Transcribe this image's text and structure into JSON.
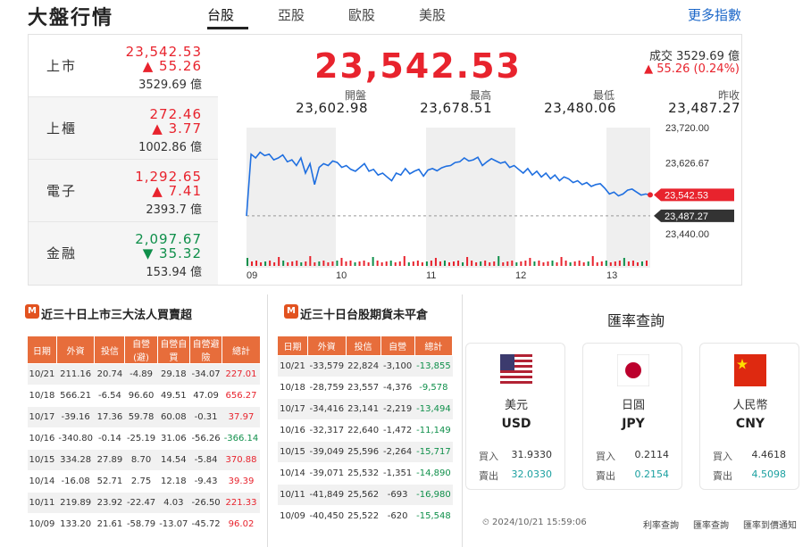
{
  "header": {
    "title": "大盤行情",
    "tabs": [
      "台股",
      "亞股",
      "歐股",
      "美股"
    ],
    "more": "更多指數"
  },
  "indices": [
    {
      "name": "上市",
      "value": "23,542.53",
      "change": "55.26",
      "volume": "3529.69 億",
      "dir": "up"
    },
    {
      "name": "上櫃",
      "value": "272.46",
      "change": "3.77",
      "volume": "1002.86 億",
      "dir": "up"
    },
    {
      "name": "電子",
      "value": "1,292.65",
      "change": "7.41",
      "volume": "2393.7 億",
      "dir": "up"
    },
    {
      "name": "金融",
      "value": "2,097.67",
      "change": "35.32",
      "volume": "153.94 億",
      "dir": "down"
    }
  ],
  "main": {
    "price": "23,542.53",
    "volume_label": "成交",
    "volume": "3529.69 億",
    "change": "▲ 55.26 (0.24%)",
    "ohlc": [
      {
        "label": "開盤",
        "value": "23,602.98"
      },
      {
        "label": "最高",
        "value": "23,678.51"
      },
      {
        "label": "最低",
        "value": "23,480.06"
      },
      {
        "label": "昨收",
        "value": "23,487.27"
      }
    ]
  },
  "chart_data": {
    "type": "line",
    "x_ticks": [
      "09",
      "10",
      "11",
      "12",
      "13"
    ],
    "y_ticks": [
      "23,720.00",
      "23,626.67",
      "23,440.00"
    ],
    "ylim": [
      23440,
      23720
    ],
    "current_label": "23,542.53",
    "prev_close_label": "23,487.27",
    "current": 23542.53,
    "prev_close": 23487.27,
    "colors": {
      "line": "#1f6fe0",
      "up": "#e8232d",
      "ref": "#333333"
    },
    "series": [
      {
        "values": [
          23487,
          23650,
          23640,
          23655,
          23646,
          23650,
          23635,
          23640,
          23648,
          23630,
          23635,
          23620,
          23640,
          23600,
          23625,
          23570,
          23615,
          23625,
          23620,
          23632,
          23628,
          23615,
          23620,
          23610,
          23605,
          23615,
          23625,
          23605,
          23610,
          23595,
          23600,
          23590,
          23580,
          23600,
          23595,
          23612,
          23598,
          23605,
          23610,
          23592,
          23608,
          23612,
          23606,
          23614,
          23618,
          23620,
          23628,
          23630,
          23640,
          23632,
          23635,
          23642,
          23620,
          23630,
          23638,
          23632,
          23626,
          23630,
          23615,
          23620,
          23610,
          23600,
          23612,
          23595,
          23605,
          23590,
          23600,
          23585,
          23595,
          23580,
          23590,
          23585,
          23575,
          23580,
          23570,
          23575,
          23565,
          23570,
          23572,
          23560,
          23545,
          23550,
          23540,
          23545,
          23555,
          23558,
          23550,
          23542,
          23545,
          23542
        ]
      }
    ]
  },
  "inst_table": {
    "title": "近三十日上市三大法人買賣超",
    "headers": [
      "日期",
      "外資",
      "投信",
      "自營(避)",
      "自營自買",
      "自營避險",
      "總計"
    ],
    "rows": [
      [
        "10/21",
        "211.16",
        "20.74",
        "-4.89",
        "29.18",
        "-34.07",
        "227.01"
      ],
      [
        "10/18",
        "566.21",
        "-6.54",
        "96.60",
        "49.51",
        "47.09",
        "656.27"
      ],
      [
        "10/17",
        "-39.16",
        "17.36",
        "59.78",
        "60.08",
        "-0.31",
        "37.97"
      ],
      [
        "10/16",
        "-340.80",
        "-0.14",
        "-25.19",
        "31.06",
        "-56.26",
        "-366.14"
      ],
      [
        "10/15",
        "334.28",
        "27.89",
        "8.70",
        "14.54",
        "-5.84",
        "370.88"
      ],
      [
        "10/14",
        "-16.08",
        "52.71",
        "2.75",
        "12.18",
        "-9.43",
        "39.39"
      ],
      [
        "10/11",
        "219.89",
        "23.92",
        "-22.47",
        "4.03",
        "-26.50",
        "221.33"
      ],
      [
        "10/09",
        "133.20",
        "21.61",
        "-58.79",
        "-13.07",
        "-45.72",
        "96.02"
      ]
    ]
  },
  "fut_table": {
    "title": "近三十日台股期貨未平倉",
    "headers": [
      "日期",
      "外資",
      "投信",
      "自營",
      "總計"
    ],
    "rows": [
      [
        "10/21",
        "-33,579",
        "22,824",
        "-3,100",
        "-13,855"
      ],
      [
        "10/18",
        "-28,759",
        "23,557",
        "-4,376",
        "-9,578"
      ],
      [
        "10/17",
        "-34,416",
        "23,141",
        "-2,219",
        "-13,494"
      ],
      [
        "10/16",
        "-32,317",
        "22,640",
        "-1,472",
        "-11,149"
      ],
      [
        "10/15",
        "-39,049",
        "25,596",
        "-2,264",
        "-15,717"
      ],
      [
        "10/14",
        "-39,071",
        "25,532",
        "-1,351",
        "-14,890"
      ],
      [
        "10/11",
        "-41,849",
        "25,562",
        "-693",
        "-16,980"
      ],
      [
        "10/09",
        "-40,450",
        "25,522",
        "-620",
        "-15,548"
      ]
    ]
  },
  "fx": {
    "title": "匯率查詢",
    "buy_label": "買入",
    "sell_label": "賣出",
    "currencies": [
      {
        "name": "美元",
        "code": "USD",
        "buy": "31.9330",
        "sell": "32.0330",
        "flag": "us-flag-icon"
      },
      {
        "name": "日圓",
        "code": "JPY",
        "buy": "0.2114",
        "sell": "0.2154",
        "flag": "jp-flag-icon"
      },
      {
        "name": "人民幣",
        "code": "CNY",
        "buy": "4.4618",
        "sell": "4.5098",
        "flag": "cn-flag-icon"
      }
    ],
    "timestamp": "2024/10/21 15:59:06",
    "links": [
      "利率查詢",
      "匯率查詢",
      "匯率到價通知"
    ]
  }
}
